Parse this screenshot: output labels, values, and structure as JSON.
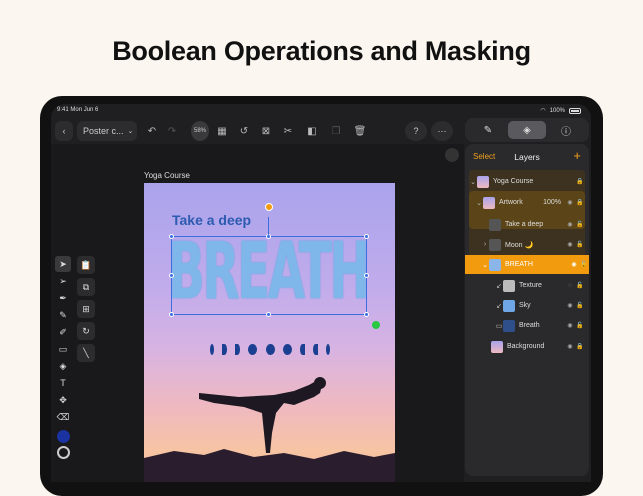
{
  "headline": "Boolean Operations and Masking",
  "status": {
    "time": "9:41",
    "date": "Mon Jun 6",
    "battery": "100%"
  },
  "toolbar": {
    "back_icon": "chevron-left-icon",
    "doc_name": "Poster c...",
    "zoom": "58%"
  },
  "panel_tabs": [
    "pen-icon",
    "layers-icon",
    "info-icon"
  ],
  "canvas": {
    "doc_label": "Yoga Course",
    "heading": "Take a deep",
    "big_word": "BREATH"
  },
  "layers_panel": {
    "select_label": "Select",
    "title": "Layers",
    "add_icon": "plus-icon",
    "items": [
      {
        "name": "Yoga Course",
        "indent": 0,
        "expand": "chevron-down",
        "percent": ""
      },
      {
        "name": "Artwork",
        "indent": 1,
        "expand": "chevron-down",
        "percent": "100%"
      },
      {
        "name": "Take a deep",
        "indent": 2,
        "expand": "",
        "percent": ""
      },
      {
        "name": "Moon 🌙",
        "indent": 2,
        "expand": "chevron-right",
        "percent": ""
      },
      {
        "name": "BREATH",
        "indent": 2,
        "expand": "chevron-down",
        "percent": ""
      },
      {
        "name": "Texture",
        "indent": 3,
        "expand": "",
        "percent": ""
      },
      {
        "name": "Sky",
        "indent": 3,
        "expand": "",
        "percent": ""
      },
      {
        "name": "Breath",
        "indent": 3,
        "expand": "",
        "percent": ""
      },
      {
        "name": "Background",
        "indent": 1,
        "expand": "",
        "percent": ""
      }
    ]
  },
  "colors": {
    "accent": "#f29b0f",
    "selection": "#3b6fe0",
    "fill_swatch": "#1a33a0"
  }
}
